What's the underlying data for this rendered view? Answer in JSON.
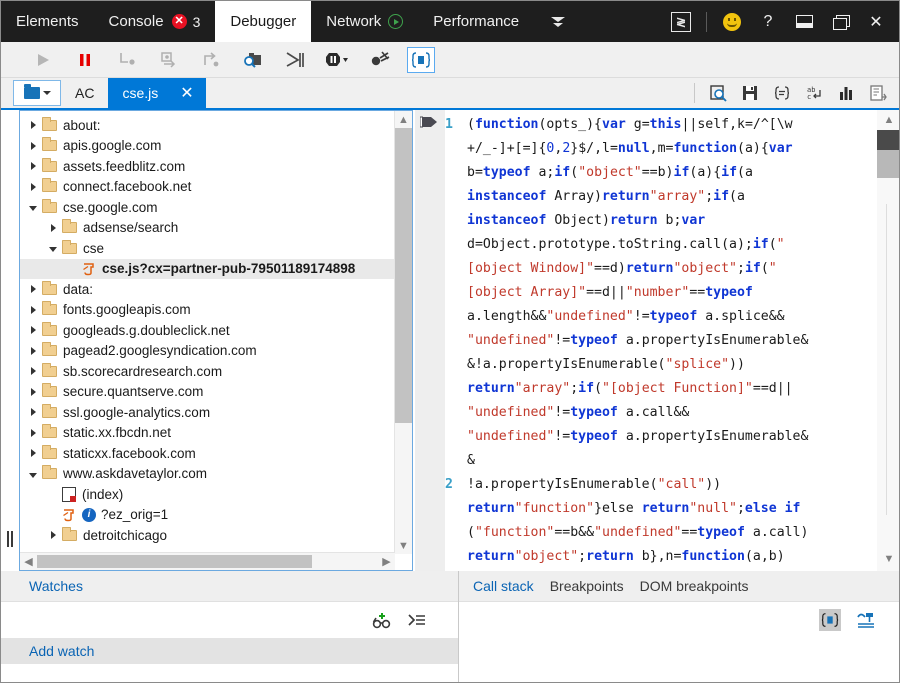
{
  "window": {
    "title": "F12 Developer Tools - Debugger"
  },
  "tabs": {
    "items": [
      {
        "label": "Elements",
        "active": false,
        "icon": ""
      },
      {
        "label": "Console",
        "active": false,
        "icon": "error-badge",
        "error_count": "3"
      },
      {
        "label": "Debugger",
        "active": true,
        "icon": ""
      },
      {
        "label": "Network",
        "active": false,
        "icon": "record-play-icon"
      },
      {
        "label": "Performance",
        "active": false,
        "icon": ""
      }
    ],
    "overflow_icon": "chevron-down-icon",
    "system_buttons": [
      {
        "name": "console-drawer-button",
        "icon": "console-prompt-icon",
        "label": "∑"
      },
      {
        "name": "feedback-button",
        "icon": "smiley-icon",
        "label": ""
      },
      {
        "name": "help-button",
        "icon": "question-mark-icon",
        "label": "?"
      },
      {
        "name": "dock-button",
        "icon": "dock-window-icon",
        "label": ""
      },
      {
        "name": "restore-button",
        "icon": "restore-window-icon",
        "label": ""
      },
      {
        "name": "close-button",
        "icon": "close-icon",
        "label": "✕"
      }
    ]
  },
  "debug_toolbar": {
    "buttons": [
      {
        "name": "continue-button",
        "icon": "play-icon",
        "label": "Continue",
        "state": "disabled"
      },
      {
        "name": "break-button",
        "icon": "pause-icon",
        "label": "Break",
        "state": "enabled"
      },
      {
        "name": "step-into-button",
        "icon": "step-into-icon",
        "label": "Step into",
        "state": "disabled"
      },
      {
        "name": "step-over-button",
        "icon": "step-over-icon",
        "label": "Step over",
        "state": "disabled"
      },
      {
        "name": "step-out-button",
        "icon": "step-out-icon",
        "label": "Step out",
        "state": "disabled"
      },
      {
        "name": "find-button",
        "icon": "folder-search-icon",
        "label": "Find",
        "state": "enabled"
      },
      {
        "name": "break-on-new-worker-button",
        "icon": "worker-break-icon",
        "label": "Break on new worker",
        "state": "enabled"
      },
      {
        "name": "break-on-exceptions-button",
        "icon": "exception-break-icon",
        "label": "Break on exceptions",
        "state": "enabled",
        "has_dropdown": true
      },
      {
        "name": "disable-breakpoints-button",
        "icon": "breakpoint-off-icon",
        "label": "Disable all breakpoints",
        "state": "enabled"
      },
      {
        "name": "pretty-print-button",
        "icon": "pretty-print-icon",
        "label": "Pretty print",
        "state": "active"
      }
    ]
  },
  "file_bar": {
    "picker": {
      "name": "file-picker",
      "icon": "folder-icon",
      "caret": "chevron-down-icon"
    },
    "script_label": "AC",
    "open_tab": {
      "label": "cse.js",
      "close": "✕"
    },
    "right_tools": [
      {
        "name": "find-in-files-button",
        "icon": "page-search-icon"
      },
      {
        "name": "save-button",
        "icon": "save-disk-icon"
      },
      {
        "name": "format-button",
        "icon": "format-braces-icon"
      },
      {
        "name": "word-wrap-button",
        "icon": "word-wrap-icon"
      },
      {
        "name": "memory-button",
        "icon": "bar-chart-icon"
      },
      {
        "name": "source-map-button",
        "icon": "source-map-icon"
      }
    ]
  },
  "file_tree": {
    "rows": [
      {
        "label": "about:",
        "indent": 0,
        "twisty": "closed",
        "icon": "folder-icon",
        "selected": false
      },
      {
        "label": "apis.google.com",
        "indent": 0,
        "twisty": "closed",
        "icon": "folder-icon",
        "selected": false
      },
      {
        "label": "assets.feedblitz.com",
        "indent": 0,
        "twisty": "closed",
        "icon": "folder-icon",
        "selected": false
      },
      {
        "label": "connect.facebook.net",
        "indent": 0,
        "twisty": "closed",
        "icon": "folder-icon",
        "selected": false
      },
      {
        "label": "cse.google.com",
        "indent": 0,
        "twisty": "open",
        "icon": "folder-icon",
        "selected": false
      },
      {
        "label": "adsense/search",
        "indent": 1,
        "twisty": "closed",
        "icon": "folder-icon",
        "selected": false
      },
      {
        "label": "cse",
        "indent": 1,
        "twisty": "open",
        "icon": "folder-icon",
        "selected": false
      },
      {
        "label": "cse.js?cx=partner-pub-79501189174898",
        "indent": 2,
        "twisty": "none",
        "icon": "js-file-icon",
        "selected": true
      },
      {
        "label": "data:",
        "indent": 0,
        "twisty": "closed",
        "icon": "folder-icon",
        "selected": false
      },
      {
        "label": "fonts.googleapis.com",
        "indent": 0,
        "twisty": "closed",
        "icon": "folder-icon",
        "selected": false
      },
      {
        "label": "googleads.g.doubleclick.net",
        "indent": 0,
        "twisty": "closed",
        "icon": "folder-icon",
        "selected": false
      },
      {
        "label": "pagead2.googlesyndication.com",
        "indent": 0,
        "twisty": "closed",
        "icon": "folder-icon",
        "selected": false
      },
      {
        "label": "sb.scorecardresearch.com",
        "indent": 0,
        "twisty": "closed",
        "icon": "folder-icon",
        "selected": false
      },
      {
        "label": "secure.quantserve.com",
        "indent": 0,
        "twisty": "closed",
        "icon": "folder-icon",
        "selected": false
      },
      {
        "label": "ssl.google-analytics.com",
        "indent": 0,
        "twisty": "closed",
        "icon": "folder-icon",
        "selected": false
      },
      {
        "label": "static.xx.fbcdn.net",
        "indent": 0,
        "twisty": "closed",
        "icon": "folder-icon",
        "selected": false
      },
      {
        "label": "staticxx.facebook.com",
        "indent": 0,
        "twisty": "closed",
        "icon": "folder-icon",
        "selected": false
      },
      {
        "label": "www.askdavetaylor.com",
        "indent": 0,
        "twisty": "open",
        "icon": "folder-icon",
        "selected": false
      },
      {
        "label": "(index)",
        "indent": 1,
        "twisty": "none",
        "icon": "html-file-icon",
        "selected": false
      },
      {
        "label": "?ez_orig=1",
        "indent": 1,
        "twisty": "none",
        "icon": "js-file-icon",
        "badge": "info-icon",
        "selected": false
      },
      {
        "label": "detroitchicago",
        "indent": 1,
        "twisty": "closed",
        "icon": "folder-icon",
        "selected": false
      }
    ]
  },
  "code": {
    "marker_icon": "current-statement-arrow",
    "lines": [
      {
        "number": "1",
        "tokens": [
          {
            "t": "(",
            "c": "plain"
          },
          {
            "t": "function",
            "c": "kw"
          },
          {
            "t": "(opts_){",
            "c": "plain"
          },
          {
            "t": "var",
            "c": "kw"
          },
          {
            "t": " g=",
            "c": "plain"
          },
          {
            "t": "this",
            "c": "kw"
          },
          {
            "t": "||self,k=/^[\\w",
            "c": "plain"
          }
        ]
      },
      {
        "number": "",
        "tokens": [
          {
            "t": "+/_-]+[=]{",
            "c": "plain"
          },
          {
            "t": "0",
            "c": "cnum"
          },
          {
            "t": ",",
            "c": "plain"
          },
          {
            "t": "2",
            "c": "cnum"
          },
          {
            "t": "}$/,l=",
            "c": "plain"
          },
          {
            "t": "null",
            "c": "kw"
          },
          {
            "t": ",m=",
            "c": "plain"
          },
          {
            "t": "function",
            "c": "kw"
          },
          {
            "t": "(a){",
            "c": "plain"
          },
          {
            "t": "var",
            "c": "kw"
          }
        ]
      },
      {
        "number": "",
        "tokens": [
          {
            "t": "b=",
            "c": "plain"
          },
          {
            "t": "typeof",
            "c": "kw"
          },
          {
            "t": " a;",
            "c": "plain"
          },
          {
            "t": "if",
            "c": "kw"
          },
          {
            "t": "(",
            "c": "plain"
          },
          {
            "t": "\"object\"",
            "c": "str"
          },
          {
            "t": "==b)",
            "c": "plain"
          },
          {
            "t": "if",
            "c": "kw"
          },
          {
            "t": "(a){",
            "c": "plain"
          },
          {
            "t": "if",
            "c": "kw"
          },
          {
            "t": "(a",
            "c": "plain"
          }
        ]
      },
      {
        "number": "",
        "tokens": [
          {
            "t": "instanceof",
            "c": "kw"
          },
          {
            "t": " Array)",
            "c": "plain"
          },
          {
            "t": "return",
            "c": "kw"
          },
          {
            "t": "\"array\"",
            "c": "str"
          },
          {
            "t": ";",
            "c": "plain"
          },
          {
            "t": "if",
            "c": "kw"
          },
          {
            "t": "(a",
            "c": "plain"
          }
        ]
      },
      {
        "number": "",
        "tokens": [
          {
            "t": "instanceof",
            "c": "kw"
          },
          {
            "t": " Object)",
            "c": "plain"
          },
          {
            "t": "return",
            "c": "kw"
          },
          {
            "t": " b;",
            "c": "plain"
          },
          {
            "t": "var",
            "c": "kw"
          }
        ]
      },
      {
        "number": "",
        "tokens": [
          {
            "t": "d=Object.prototype.toString.call(a);",
            "c": "plain"
          },
          {
            "t": "if",
            "c": "kw"
          },
          {
            "t": "(",
            "c": "plain"
          },
          {
            "t": "\"",
            "c": "str"
          }
        ]
      },
      {
        "number": "",
        "tokens": [
          {
            "t": "[object Window]\"",
            "c": "str"
          },
          {
            "t": "==d)",
            "c": "plain"
          },
          {
            "t": "return",
            "c": "kw"
          },
          {
            "t": "\"object\"",
            "c": "str"
          },
          {
            "t": ";",
            "c": "plain"
          },
          {
            "t": "if",
            "c": "kw"
          },
          {
            "t": "(",
            "c": "plain"
          },
          {
            "t": "\"",
            "c": "str"
          }
        ]
      },
      {
        "number": "",
        "tokens": [
          {
            "t": "[object Array]\"",
            "c": "str"
          },
          {
            "t": "==d||",
            "c": "plain"
          },
          {
            "t": "\"number\"",
            "c": "str"
          },
          {
            "t": "==",
            "c": "plain"
          },
          {
            "t": "typeof",
            "c": "kw"
          }
        ]
      },
      {
        "number": "",
        "tokens": [
          {
            "t": "a.length&&",
            "c": "plain"
          },
          {
            "t": "\"undefined\"",
            "c": "str"
          },
          {
            "t": "!=",
            "c": "plain"
          },
          {
            "t": "typeof",
            "c": "kw"
          },
          {
            "t": " a.splice&&",
            "c": "plain"
          }
        ]
      },
      {
        "number": "",
        "tokens": [
          {
            "t": "\"undefined\"",
            "c": "str"
          },
          {
            "t": "!=",
            "c": "plain"
          },
          {
            "t": "typeof",
            "c": "kw"
          },
          {
            "t": " a.propertyIsEnumerable&",
            "c": "plain"
          }
        ]
      },
      {
        "number": "",
        "tokens": [
          {
            "t": "&!a.propertyIsEnumerable(",
            "c": "plain"
          },
          {
            "t": "\"splice\"",
            "c": "str"
          },
          {
            "t": "))",
            "c": "plain"
          }
        ]
      },
      {
        "number": "",
        "tokens": [
          {
            "t": "return",
            "c": "kw"
          },
          {
            "t": "\"array\"",
            "c": "str"
          },
          {
            "t": ";",
            "c": "plain"
          },
          {
            "t": "if",
            "c": "kw"
          },
          {
            "t": "(",
            "c": "plain"
          },
          {
            "t": "\"[object Function]\"",
            "c": "str"
          },
          {
            "t": "==d||",
            "c": "plain"
          }
        ]
      },
      {
        "number": "",
        "tokens": [
          {
            "t": "\"undefined\"",
            "c": "str"
          },
          {
            "t": "!=",
            "c": "plain"
          },
          {
            "t": "typeof",
            "c": "kw"
          },
          {
            "t": " a.call&&",
            "c": "plain"
          }
        ]
      },
      {
        "number": "",
        "tokens": [
          {
            "t": "\"undefined\"",
            "c": "str"
          },
          {
            "t": "!=",
            "c": "plain"
          },
          {
            "t": "typeof",
            "c": "kw"
          },
          {
            "t": " a.propertyIsEnumerable&",
            "c": "plain"
          }
        ]
      },
      {
        "number": "",
        "tokens": [
          {
            "t": "&",
            "c": "plain"
          }
        ]
      },
      {
        "number": "2",
        "tokens": [
          {
            "t": "!a.propertyIsEnumerable(",
            "c": "plain"
          },
          {
            "t": "\"call\"",
            "c": "str"
          },
          {
            "t": "))",
            "c": "plain"
          }
        ]
      },
      {
        "number": "",
        "tokens": [
          {
            "t": "return",
            "c": "kw"
          },
          {
            "t": "\"function\"",
            "c": "str"
          },
          {
            "t": "}else ",
            "c": "plain"
          },
          {
            "t": "return",
            "c": "kw"
          },
          {
            "t": "\"null\"",
            "c": "str"
          },
          {
            "t": ";",
            "c": "plain"
          },
          {
            "t": "else if",
            "c": "kw"
          }
        ]
      },
      {
        "number": "",
        "tokens": [
          {
            "t": "(",
            "c": "plain"
          },
          {
            "t": "\"function\"",
            "c": "str"
          },
          {
            "t": "==b&&",
            "c": "plain"
          },
          {
            "t": "\"undefined\"",
            "c": "str"
          },
          {
            "t": "==",
            "c": "plain"
          },
          {
            "t": "typeof",
            "c": "kw"
          },
          {
            "t": " a.call)",
            "c": "plain"
          }
        ]
      },
      {
        "number": "",
        "tokens": [
          {
            "t": "return",
            "c": "kw"
          },
          {
            "t": "\"object\"",
            "c": "str"
          },
          {
            "t": ";",
            "c": "plain"
          },
          {
            "t": "return",
            "c": "kw"
          },
          {
            "t": " b},n=",
            "c": "plain"
          },
          {
            "t": "function",
            "c": "kw"
          },
          {
            "t": "(a,b)",
            "c": "plain"
          }
        ]
      }
    ]
  },
  "watches_panel": {
    "title": "Watches",
    "tools": [
      {
        "name": "add-watch-button",
        "icon": "add-watch-icon"
      },
      {
        "name": "collapse-watches-button",
        "icon": "collapse-all-icon"
      }
    ],
    "add_watch_label": "Add watch"
  },
  "callstack_panel": {
    "tabs": [
      {
        "label": "Call stack",
        "selected": true
      },
      {
        "label": "Breakpoints",
        "selected": false
      },
      {
        "label": "DOM breakpoints",
        "selected": false
      }
    ],
    "tools": [
      {
        "name": "show-library-frames-button",
        "icon": "library-frames-icon",
        "active": true
      },
      {
        "name": "async-stack-button",
        "icon": "async-stack-icon",
        "active": false
      }
    ]
  },
  "colors": {
    "accent": "#0078d7",
    "tabbar_bg": "#1e1e1e",
    "toolbar_bg": "#f0f0f0",
    "error_red": "#e81123",
    "keyword_blue": "#0f35d4",
    "string_red": "#c0392b",
    "lineno_cyan": "#3aa0c8"
  }
}
